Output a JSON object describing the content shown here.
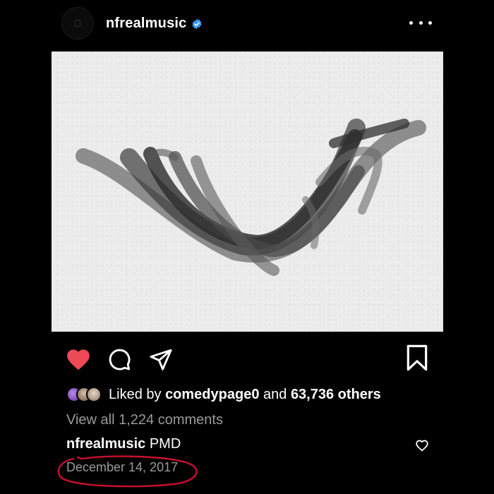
{
  "header": {
    "username": "nfrealmusic",
    "verified_icon": "verified-badge-icon",
    "more_icon": "more-options-icon"
  },
  "photo": {
    "description_icon": "brush-stroke-artwork"
  },
  "actions": {
    "like_icon": "heart-filled-icon",
    "like_color": "#ed4956",
    "comment_icon": "comment-bubble-icon",
    "share_icon": "paper-plane-icon",
    "save_icon": "bookmark-icon"
  },
  "likes": {
    "prefix": "Liked by ",
    "user": "comedypage0",
    "middle": " and ",
    "others": "63,736 others"
  },
  "comments": {
    "view_all": "View all 1,224 comments"
  },
  "caption": {
    "user": "nfrealmusic",
    "text": " PMD"
  },
  "post": {
    "date": "December 14, 2017",
    "annotation_color": "#c8102e"
  },
  "colors": {
    "background": "#000000",
    "verified": "#3897f0",
    "muted_text": "#9a9a9a"
  }
}
